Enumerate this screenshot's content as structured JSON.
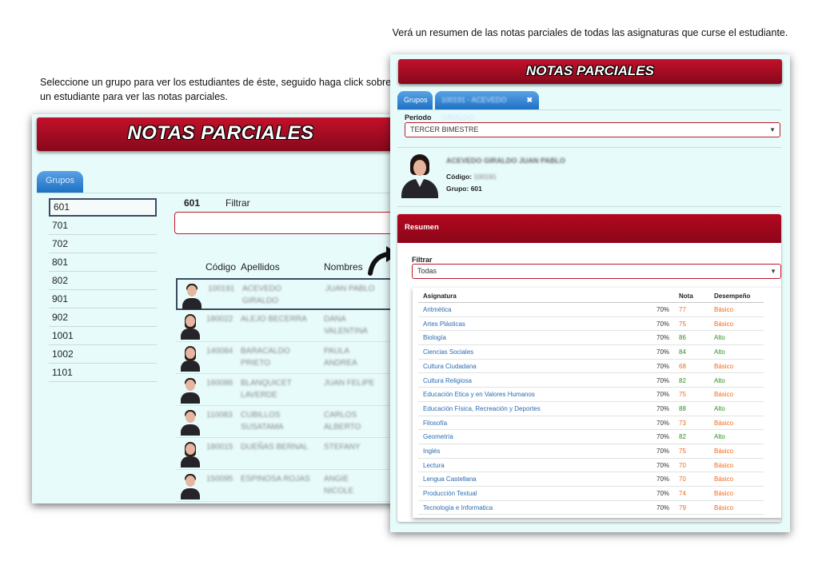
{
  "captions": {
    "left": "Seleccione un grupo para ver los estudiantes de éste, seguido haga click sobre un estudiante para ver las notas parciales.",
    "right": "Verá un resumen de las notas parciales de todas las asignaturas que curse el estudiante."
  },
  "left_panel": {
    "title": "NOTAS PARCIALES",
    "tab_label": "Grupos",
    "groups": [
      "601",
      "701",
      "702",
      "801",
      "802",
      "901",
      "902",
      "1001",
      "1002",
      "1101"
    ],
    "selected_group": "601",
    "filter_label": "Filtrar",
    "filter_value": "",
    "columns": {
      "codigo": "Código",
      "apellidos": "Apellidos",
      "nombres": "Nombres"
    },
    "students": [
      {
        "codigo": "100191",
        "apellidos": "ACEVEDO GIRALDO",
        "nombres": "JUAN PABLO"
      },
      {
        "codigo": "180022",
        "apellidos": "ALEJO BECERRA",
        "nombres": "DANA VALENTINA"
      },
      {
        "codigo": "140084",
        "apellidos": "BARACALDO PRIETO",
        "nombres": "PAULA ANDREA"
      },
      {
        "codigo": "160086",
        "apellidos": "BLANQUICET LAVERDE",
        "nombres": "JUAN FELIPE"
      },
      {
        "codigo": "110083",
        "apellidos": "CUBILLOS SUSATAMA",
        "nombres": "CARLOS ALBERTO"
      },
      {
        "codigo": "180015",
        "apellidos": "DUEÑAS BERNAL",
        "nombres": "STEFANY"
      },
      {
        "codigo": "150095",
        "apellidos": "ESPINOSA ROJAS",
        "nombres": "ANGIE NICOLE"
      }
    ]
  },
  "right_panel": {
    "title": "NOTAS PARCIALES",
    "tabs": {
      "grupos": "Grupos",
      "student": "100191 - ACEVEDO GIRALDO",
      "close": "✖"
    },
    "periodo_label": "Periodo",
    "periodo_value": "TERCER BIMESTRE",
    "student_name": "ACEVEDO GIRALDO JUAN PABLO",
    "codigo_label": "Código:",
    "codigo_value": "100191",
    "grupo_label": "Grupo:",
    "grupo_value": "601",
    "resumen_title": "Resumen",
    "filtrar_label": "Filtrar",
    "filtrar_value": "Todas",
    "grade_columns": {
      "asignatura": "Asignatura",
      "nota": "Nota",
      "desempeno": "Desempeño"
    },
    "grades": [
      {
        "asignatura": "Aritmética",
        "pct": "70%",
        "nota": "77",
        "desempeno": "Básico"
      },
      {
        "asignatura": "Artes Plásticas",
        "pct": "70%",
        "nota": "75",
        "desempeno": "Básico"
      },
      {
        "asignatura": "Biología",
        "pct": "70%",
        "nota": "86",
        "desempeno": "Alto"
      },
      {
        "asignatura": "Ciencias Sociales",
        "pct": "70%",
        "nota": "84",
        "desempeno": "Alto"
      },
      {
        "asignatura": "Cultura Ciudadana",
        "pct": "70%",
        "nota": "68",
        "desempeno": "Básico"
      },
      {
        "asignatura": "Cultura Religiosa",
        "pct": "70%",
        "nota": "82",
        "desempeno": "Alto"
      },
      {
        "asignatura": "Educación Etica y en Valores Humanos",
        "pct": "70%",
        "nota": "75",
        "desempeno": "Básico"
      },
      {
        "asignatura": "Educación Física, Recreación y Deportes",
        "pct": "70%",
        "nota": "88",
        "desempeno": "Alto"
      },
      {
        "asignatura": "Filosofía",
        "pct": "70%",
        "nota": "73",
        "desempeno": "Básico"
      },
      {
        "asignatura": "Geometría",
        "pct": "70%",
        "nota": "82",
        "desempeno": "Alto"
      },
      {
        "asignatura": "Inglés",
        "pct": "70%",
        "nota": "75",
        "desempeno": "Básico"
      },
      {
        "asignatura": "Lectura",
        "pct": "70%",
        "nota": "70",
        "desempeno": "Básico"
      },
      {
        "asignatura": "Lengua Castellana",
        "pct": "70%",
        "nota": "70",
        "desempeno": "Básico"
      },
      {
        "asignatura": "Producción Textual",
        "pct": "70%",
        "nota": "74",
        "desempeno": "Básico"
      },
      {
        "asignatura": "Tecnología e Informatica",
        "pct": "70%",
        "nota": "79",
        "desempeno": "Básico"
      }
    ]
  },
  "colors": {
    "banner": "#a50d23",
    "tab_blue": "#2a7bd0",
    "panel_bg": "#e8fbfb",
    "basico": "#f26b1d",
    "alto": "#2f8f22",
    "link": "#2b6cb0"
  }
}
